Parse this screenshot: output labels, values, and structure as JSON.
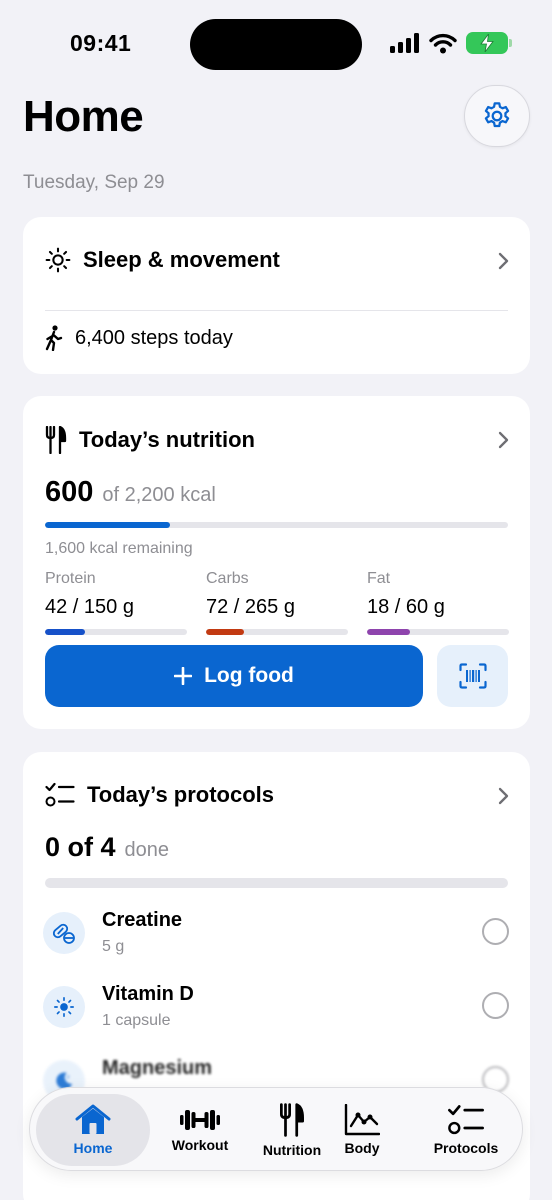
{
  "status": {
    "time": "09:41"
  },
  "header": {
    "title": "Home",
    "date": "Tuesday, Sep 29"
  },
  "sleep": {
    "title": "Sleep & movement",
    "steps": "6,400 steps today"
  },
  "nutrition": {
    "title": "Today’s nutrition",
    "consumed": "600",
    "goal_text": "of 2,200 kcal",
    "progress": 0.27,
    "remaining": "1,600 kcal remaining",
    "macros": [
      {
        "name": "Protein",
        "value": "42 / 150 g",
        "progress": 0.28,
        "color": "#1651C9"
      },
      {
        "name": "Carbs",
        "value": "72 / 265 g",
        "progress": 0.27,
        "color": "#C23A12"
      },
      {
        "name": "Fat",
        "value": "18 / 60 g",
        "progress": 0.3,
        "color": "#8E44AD"
      }
    ],
    "log_label": "Log food"
  },
  "protocols": {
    "title": "Today’s protocols",
    "done_count": "0 of 4",
    "done_word": "done",
    "progress": 0,
    "items": [
      {
        "name": "Creatine",
        "dose": "5 g",
        "icon": "pill-icon"
      },
      {
        "name": "Vitamin D",
        "dose": "1 capsule",
        "icon": "sun-icon"
      },
      {
        "name": "Magnesium",
        "dose": "",
        "icon": "moon-icon"
      }
    ]
  },
  "tabs": [
    {
      "label": "Home",
      "icon": "house-icon",
      "active": true
    },
    {
      "label": "Workout",
      "icon": "dumbbell-icon"
    },
    {
      "label": "Nutrition",
      "icon": "fork-knife-icon"
    },
    {
      "label": "Body",
      "icon": "chart-icon"
    },
    {
      "label": "Protocols",
      "icon": "checklist-icon"
    }
  ],
  "colors": {
    "accent": "#0A66D0",
    "background": "#F2F2F7",
    "card": "#FFFFFF",
    "secondary_text": "#8E8E93",
    "battery": "#34C759"
  }
}
